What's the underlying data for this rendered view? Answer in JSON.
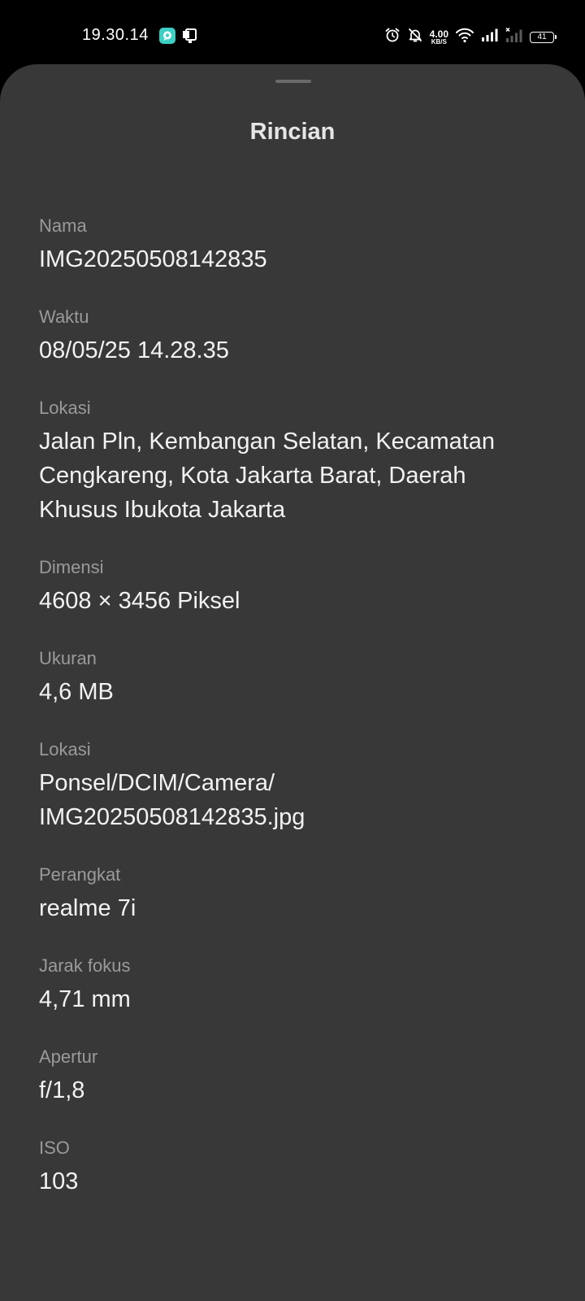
{
  "status_bar": {
    "time": "19.30.14",
    "net_speed_value": "4.00",
    "net_speed_unit": "KB/S",
    "battery": "41"
  },
  "sheet": {
    "title": "Rincian"
  },
  "details": [
    {
      "label": "Nama",
      "value": "IMG20250508142835"
    },
    {
      "label": "Waktu",
      "value": "08/05/25 14.28.35"
    },
    {
      "label": "Lokasi",
      "value": "Jalan Pln, Kembangan Selatan, Kecamatan Cengkareng, Kota Jakarta Barat, Daerah Khusus Ibukota Jakarta"
    },
    {
      "label": "Dimensi",
      "value": "4608 × 3456 Piksel"
    },
    {
      "label": "Ukuran",
      "value": "4,6 MB"
    },
    {
      "label": "Lokasi",
      "value": "Ponsel/DCIM/Camera/\nIMG20250508142835.jpg"
    },
    {
      "label": "Perangkat",
      "value": "realme 7i"
    },
    {
      "label": "Jarak fokus",
      "value": "4,71 mm"
    },
    {
      "label": "Apertur",
      "value": "f/1,8"
    },
    {
      "label": "ISO",
      "value": "103"
    }
  ],
  "icons": {
    "status_left": [
      "chat-app-icon",
      "screenshot-notification-icon"
    ],
    "status_right": [
      "alarm-icon",
      "bell-off-icon",
      "wifi-icon",
      "signal-icon",
      "signal-no-service-icon",
      "battery-icon"
    ]
  },
  "colors": {
    "sheet_background": "#383838",
    "label": "#9a9a9a",
    "value": "#f2f2f2",
    "chat_icon": "#3ccfc4"
  }
}
